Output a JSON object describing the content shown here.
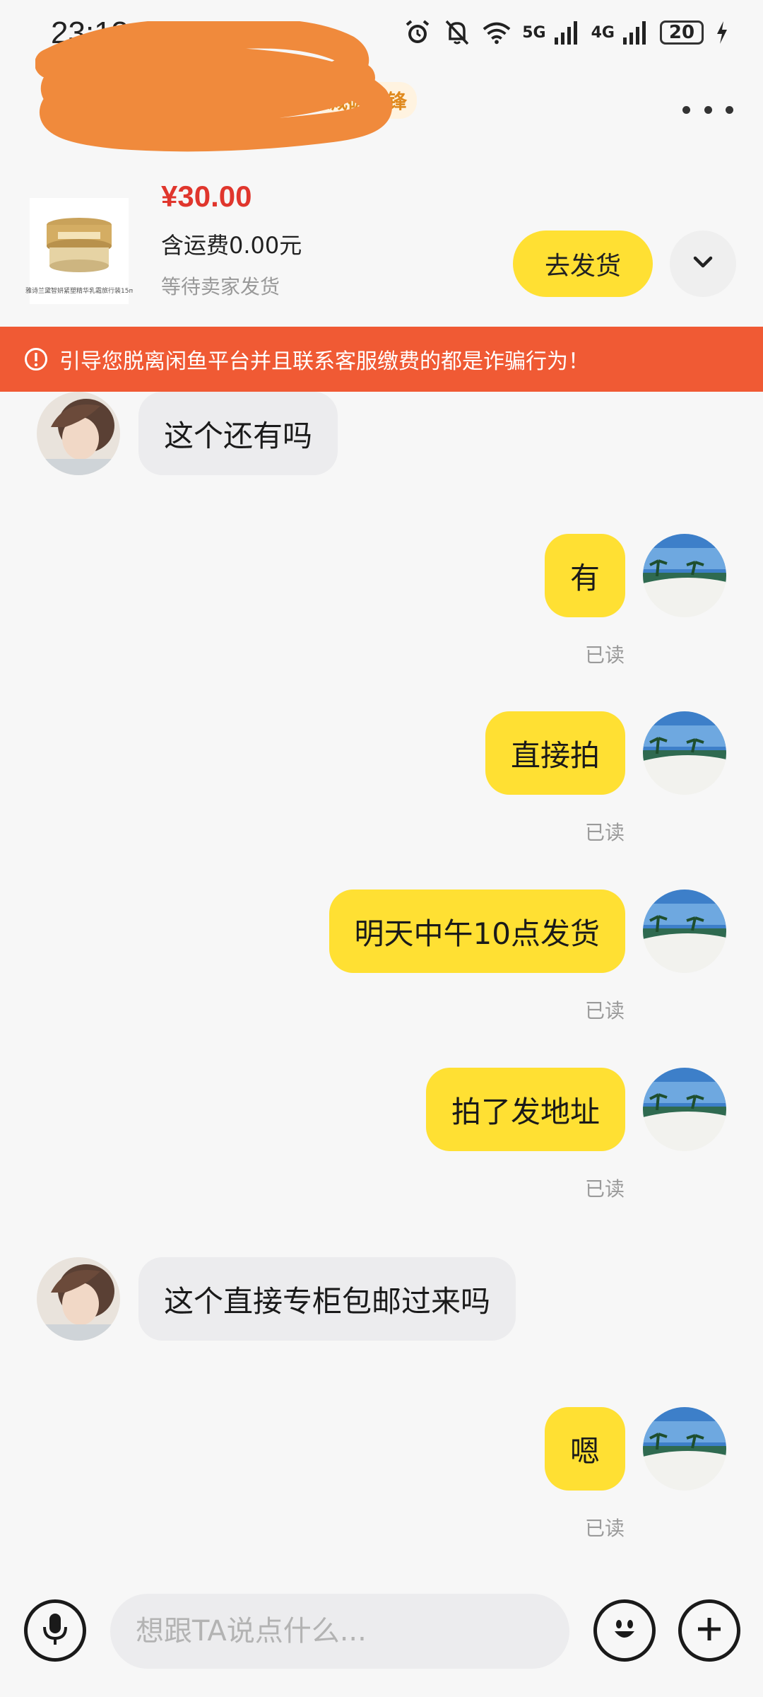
{
  "status_bar": {
    "time": "23:13",
    "network_5g": "5G",
    "network_4g": "4G",
    "battery": "20"
  },
  "header": {
    "badge": "减碳先锋",
    "redacted_title": ""
  },
  "product": {
    "price": "¥30.00",
    "shipping": "含运费0.00元",
    "status": "等待卖家发货",
    "thumb_caption": "雅诗兰黛智妍紧塑精华乳霜旅行装15ml",
    "ship_button": "去发货"
  },
  "warning": {
    "text": "引导您脱离闲鱼平台并且联系客服缴费的都是诈骗行为！"
  },
  "messages": [
    {
      "side": "in",
      "text": "这个还有吗"
    },
    {
      "side": "out",
      "text": "有",
      "status": "已读"
    },
    {
      "side": "out",
      "text": "直接拍",
      "status": "已读"
    },
    {
      "side": "out",
      "text": "明天中午10点发货",
      "status": "已读"
    },
    {
      "side": "out",
      "text": "拍了发地址",
      "status": "已读"
    },
    {
      "side": "in",
      "text": "这个直接专柜包邮过来吗"
    },
    {
      "side": "out",
      "text": "嗯",
      "status": "已读"
    }
  ],
  "input": {
    "placeholder": "想跟TA说点什么..."
  },
  "icons": {
    "status_left": [
      "eye-icon",
      "nfc-icon"
    ],
    "status_right": [
      "alarm-icon",
      "bell-off-icon",
      "wifi-icon",
      "signal-5g-icon",
      "signal-4g-icon",
      "battery-icon",
      "charging-icon"
    ],
    "header": [
      "more-icon",
      "chevron-down-icon"
    ],
    "input_bar": [
      "microphone-icon",
      "emoji-icon",
      "plus-icon"
    ]
  },
  "colors": {
    "accent": "#ffe033",
    "warning": "#f05a34",
    "price": "#e0362d",
    "badge_text": "#e08a1e",
    "redaction": "#f08a3c"
  }
}
